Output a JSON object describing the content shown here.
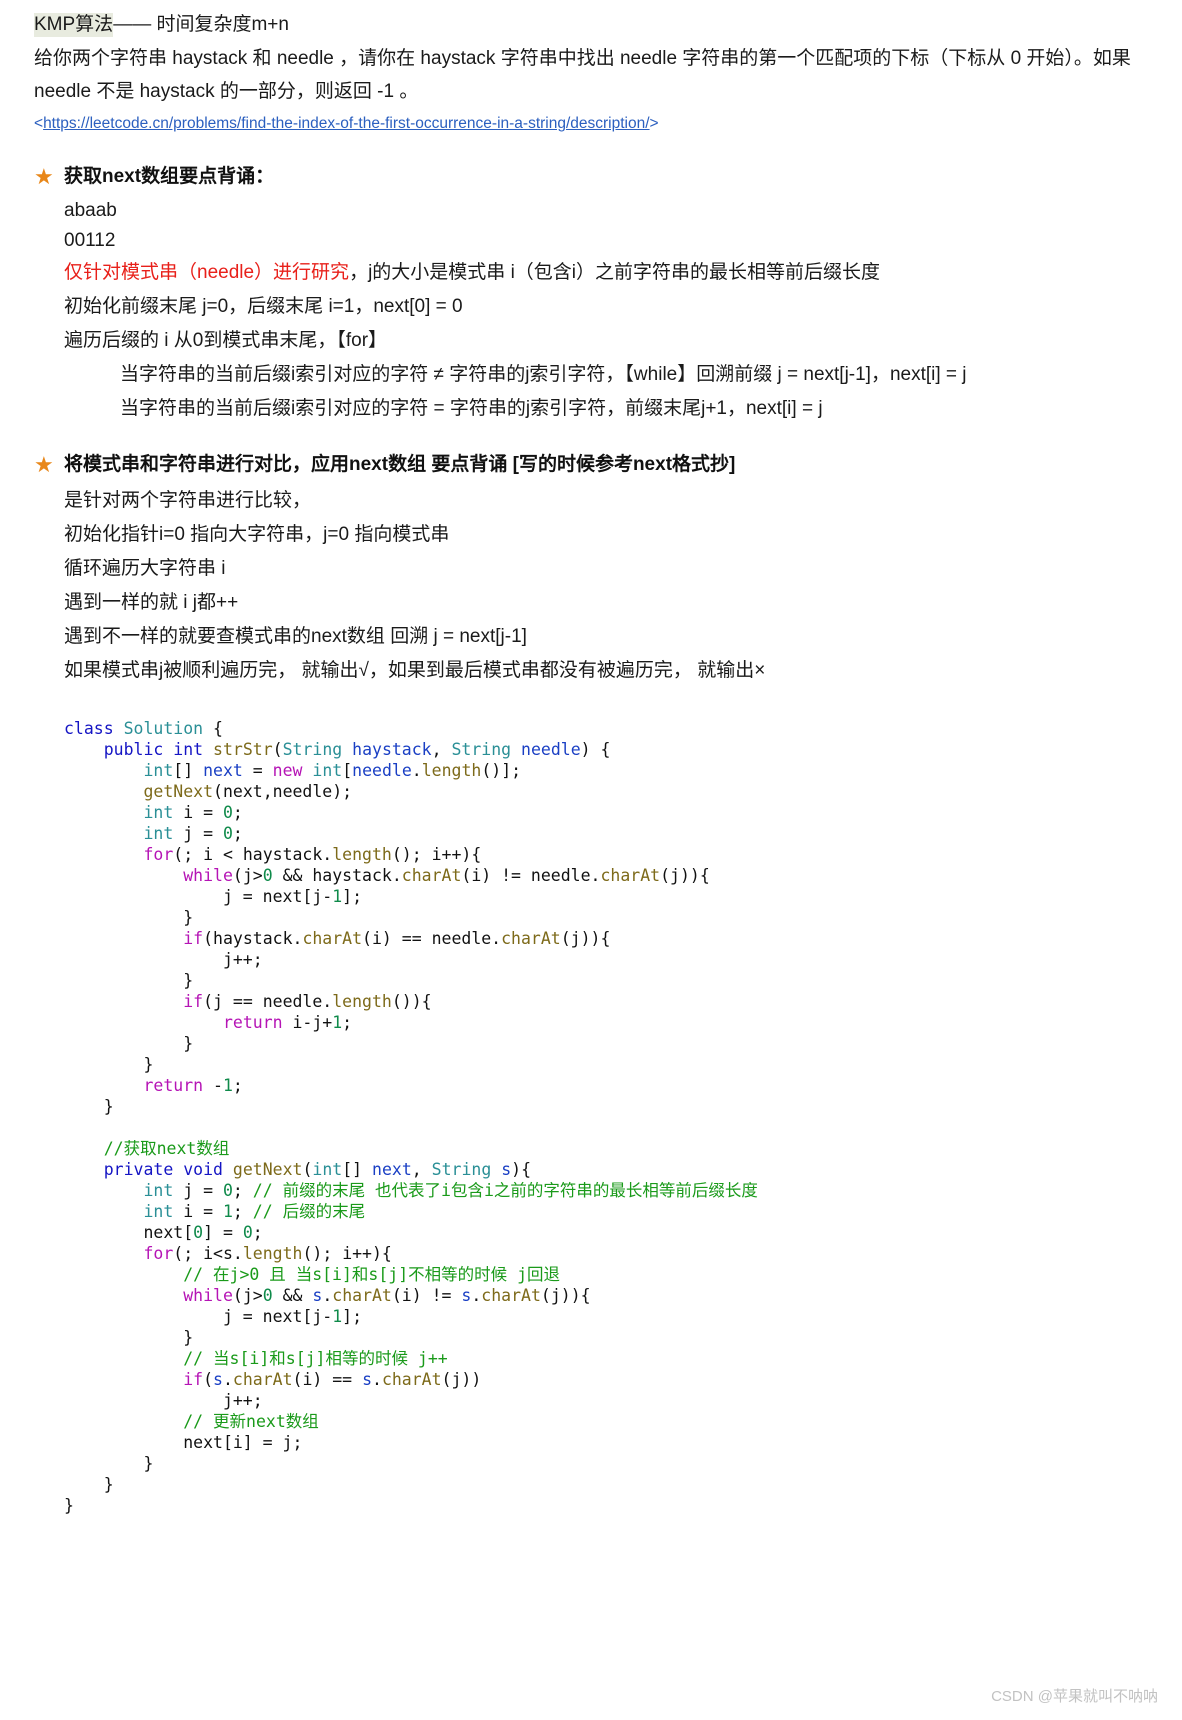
{
  "document": {
    "title_prefix": "KMP算法",
    "title_rest": "—— 时间复杂度m+n",
    "problem_statement": "给你两个字符串 haystack 和 needle ，请你在 haystack 字符串中找出 needle 字符串的第一个匹配项的下标（下标从 0 开始）。如果 needle 不是 haystack 的一部分，则返回 -1 。",
    "link_text": "https://leetcode.cn/problems/find-the-index-of-the-first-occurrence-in-a-string/description/",
    "link_open": "<",
    "link_close": ">"
  },
  "sections": [
    {
      "star": "★",
      "heading": "获取next数组要点背诵：",
      "lines": [
        {
          "text": "abaab",
          "style": "plain"
        },
        {
          "text": "00112",
          "style": "plain"
        },
        {
          "red": "仅针对模式串（needle）进行研究",
          "rest": "，j的大小是模式串 i（包含i）之前字符串的最长相等前后缀长度",
          "style": "split-red"
        },
        {
          "text": "初始化前缀末尾 j=0，后缀末尾 i=1，next[0] = 0",
          "style": "plain"
        },
        {
          "text": "遍历后缀的 i 从0到模式串末尾，【for】",
          "style": "plain"
        },
        {
          "text": "当字符串的当前后缀i索引对应的字符 ≠ 字符串的j索引字符，【while】回溯前缀 j = next[j-1]，next[i] = j",
          "style": "indent"
        },
        {
          "text": "当字符串的当前后缀i索引对应的字符 = 字符串的j索引字符，前缀末尾j+1，next[i] = j",
          "style": "indent"
        }
      ]
    },
    {
      "star": "★",
      "heading": "将模式串和字符串进行对比，应用next数组 要点背诵 [写的时候参考next格式抄]",
      "lines": [
        {
          "text": "是针对两个字符串进行比较，",
          "style": "plain"
        },
        {
          "text": "初始化指针i=0 指向大字符串，j=0 指向模式串",
          "style": "plain"
        },
        {
          "text": "循环遍历大字符串 i",
          "style": "plain"
        },
        {
          "text": "遇到一样的就 i j都++",
          "style": "plain"
        },
        {
          "text": "遇到不一样的就要查模式串的next数组 回溯 j = next[j-1]",
          "style": "plain"
        },
        {
          "text": "如果模式串j被顺利遍历完， 就输出√，如果到最后模式串都没有被遍历完， 就输出×",
          "style": "plain"
        }
      ]
    }
  ],
  "code": {
    "language": "java",
    "lines": [
      [
        {
          "t": "class ",
          "c": "kw"
        },
        {
          "t": "Solution",
          "c": "type"
        },
        {
          "t": " {",
          "c": "plain"
        }
      ],
      [
        {
          "t": "    ",
          "c": "plain"
        },
        {
          "t": "public",
          "c": "kw"
        },
        {
          "t": " ",
          "c": "plain"
        },
        {
          "t": "int",
          "c": "kw"
        },
        {
          "t": " ",
          "c": "plain"
        },
        {
          "t": "strStr",
          "c": "fn"
        },
        {
          "t": "(",
          "c": "plain"
        },
        {
          "t": "String",
          "c": "type"
        },
        {
          "t": " ",
          "c": "plain"
        },
        {
          "t": "haystack",
          "c": "var"
        },
        {
          "t": ", ",
          "c": "plain"
        },
        {
          "t": "String",
          "c": "type"
        },
        {
          "t": " ",
          "c": "plain"
        },
        {
          "t": "needle",
          "c": "var"
        },
        {
          "t": ") {",
          "c": "plain"
        }
      ],
      [
        {
          "t": "        ",
          "c": "plain"
        },
        {
          "t": "int",
          "c": "type"
        },
        {
          "t": "[] ",
          "c": "plain"
        },
        {
          "t": "next",
          "c": "var"
        },
        {
          "t": " = ",
          "c": "plain"
        },
        {
          "t": "new",
          "c": "kw2"
        },
        {
          "t": " ",
          "c": "plain"
        },
        {
          "t": "int",
          "c": "type"
        },
        {
          "t": "[",
          "c": "plain"
        },
        {
          "t": "needle",
          "c": "var"
        },
        {
          "t": ".",
          "c": "plain"
        },
        {
          "t": "length",
          "c": "fn"
        },
        {
          "t": "()];",
          "c": "plain"
        }
      ],
      [
        {
          "t": "        ",
          "c": "plain"
        },
        {
          "t": "getNext",
          "c": "fn"
        },
        {
          "t": "(next,needle);",
          "c": "plain"
        }
      ],
      [
        {
          "t": "        ",
          "c": "plain"
        },
        {
          "t": "int",
          "c": "type"
        },
        {
          "t": " i = ",
          "c": "plain"
        },
        {
          "t": "0",
          "c": "num"
        },
        {
          "t": ";",
          "c": "plain"
        }
      ],
      [
        {
          "t": "        ",
          "c": "plain"
        },
        {
          "t": "int",
          "c": "type"
        },
        {
          "t": " j = ",
          "c": "plain"
        },
        {
          "t": "0",
          "c": "num"
        },
        {
          "t": ";",
          "c": "plain"
        }
      ],
      [
        {
          "t": "        ",
          "c": "plain"
        },
        {
          "t": "for",
          "c": "kw2"
        },
        {
          "t": "(; i < haystack.",
          "c": "plain"
        },
        {
          "t": "length",
          "c": "fn"
        },
        {
          "t": "(); i++){",
          "c": "plain"
        }
      ],
      [
        {
          "t": "            ",
          "c": "plain"
        },
        {
          "t": "while",
          "c": "kw2"
        },
        {
          "t": "(j>",
          "c": "plain"
        },
        {
          "t": "0",
          "c": "num"
        },
        {
          "t": " && haystack.",
          "c": "plain"
        },
        {
          "t": "charAt",
          "c": "fn"
        },
        {
          "t": "(i) != needle.",
          "c": "plain"
        },
        {
          "t": "charAt",
          "c": "fn"
        },
        {
          "t": "(j)){",
          "c": "plain"
        }
      ],
      [
        {
          "t": "                j = next[j-",
          "c": "plain"
        },
        {
          "t": "1",
          "c": "num"
        },
        {
          "t": "];",
          "c": "plain"
        }
      ],
      [
        {
          "t": "            }",
          "c": "plain"
        }
      ],
      [
        {
          "t": "            ",
          "c": "plain"
        },
        {
          "t": "if",
          "c": "kw2"
        },
        {
          "t": "(haystack.",
          "c": "plain"
        },
        {
          "t": "charAt",
          "c": "fn"
        },
        {
          "t": "(i) == needle.",
          "c": "plain"
        },
        {
          "t": "charAt",
          "c": "fn"
        },
        {
          "t": "(j)){",
          "c": "plain"
        }
      ],
      [
        {
          "t": "                j++;",
          "c": "plain"
        }
      ],
      [
        {
          "t": "            }",
          "c": "plain"
        }
      ],
      [
        {
          "t": "            ",
          "c": "plain"
        },
        {
          "t": "if",
          "c": "kw2"
        },
        {
          "t": "(j == needle.",
          "c": "plain"
        },
        {
          "t": "length",
          "c": "fn"
        },
        {
          "t": "()){",
          "c": "plain"
        }
      ],
      [
        {
          "t": "                ",
          "c": "plain"
        },
        {
          "t": "return",
          "c": "kw2"
        },
        {
          "t": " i-j+",
          "c": "plain"
        },
        {
          "t": "1",
          "c": "num"
        },
        {
          "t": ";",
          "c": "plain"
        }
      ],
      [
        {
          "t": "            }",
          "c": "plain"
        }
      ],
      [
        {
          "t": "        }",
          "c": "plain"
        }
      ],
      [
        {
          "t": "        ",
          "c": "plain"
        },
        {
          "t": "return",
          "c": "kw2"
        },
        {
          "t": " -",
          "c": "plain"
        },
        {
          "t": "1",
          "c": "num"
        },
        {
          "t": ";",
          "c": "plain"
        }
      ],
      [
        {
          "t": "    }",
          "c": "plain"
        }
      ],
      [
        {
          "t": "",
          "c": "plain"
        }
      ],
      [
        {
          "t": "    ",
          "c": "plain"
        },
        {
          "t": "//获取next数组",
          "c": "cmt"
        }
      ],
      [
        {
          "t": "    ",
          "c": "plain"
        },
        {
          "t": "private",
          "c": "kw"
        },
        {
          "t": " ",
          "c": "plain"
        },
        {
          "t": "void",
          "c": "kw"
        },
        {
          "t": " ",
          "c": "plain"
        },
        {
          "t": "getNext",
          "c": "fn"
        },
        {
          "t": "(",
          "c": "plain"
        },
        {
          "t": "int",
          "c": "type"
        },
        {
          "t": "[] ",
          "c": "plain"
        },
        {
          "t": "next",
          "c": "var"
        },
        {
          "t": ", ",
          "c": "plain"
        },
        {
          "t": "String",
          "c": "type"
        },
        {
          "t": " ",
          "c": "plain"
        },
        {
          "t": "s",
          "c": "var"
        },
        {
          "t": "){",
          "c": "plain"
        }
      ],
      [
        {
          "t": "        ",
          "c": "plain"
        },
        {
          "t": "int",
          "c": "type"
        },
        {
          "t": " j = ",
          "c": "plain"
        },
        {
          "t": "0",
          "c": "num"
        },
        {
          "t": "; ",
          "c": "plain"
        },
        {
          "t": "// 前缀的末尾 也代表了i包含i之前的字符串的最长相等前后缀长度",
          "c": "cmt"
        }
      ],
      [
        {
          "t": "        ",
          "c": "plain"
        },
        {
          "t": "int",
          "c": "type"
        },
        {
          "t": " i = ",
          "c": "plain"
        },
        {
          "t": "1",
          "c": "num"
        },
        {
          "t": "; ",
          "c": "plain"
        },
        {
          "t": "// 后缀的末尾",
          "c": "cmt"
        }
      ],
      [
        {
          "t": "        next[",
          "c": "plain"
        },
        {
          "t": "0",
          "c": "num"
        },
        {
          "t": "] = ",
          "c": "plain"
        },
        {
          "t": "0",
          "c": "num"
        },
        {
          "t": ";",
          "c": "plain"
        }
      ],
      [
        {
          "t": "        ",
          "c": "plain"
        },
        {
          "t": "for",
          "c": "kw2"
        },
        {
          "t": "(; i<s.",
          "c": "plain"
        },
        {
          "t": "length",
          "c": "fn"
        },
        {
          "t": "(); i++){",
          "c": "plain"
        }
      ],
      [
        {
          "t": "            ",
          "c": "plain"
        },
        {
          "t": "// 在j>0 且 当s[i]和s[j]不相等的时候 j回退",
          "c": "cmt"
        }
      ],
      [
        {
          "t": "            ",
          "c": "plain"
        },
        {
          "t": "while",
          "c": "kw2"
        },
        {
          "t": "(j>",
          "c": "plain"
        },
        {
          "t": "0",
          "c": "num"
        },
        {
          "t": " && ",
          "c": "plain"
        },
        {
          "t": "s",
          "c": "var"
        },
        {
          "t": ".",
          "c": "plain"
        },
        {
          "t": "charAt",
          "c": "fn"
        },
        {
          "t": "(i) != ",
          "c": "plain"
        },
        {
          "t": "s",
          "c": "var"
        },
        {
          "t": ".",
          "c": "plain"
        },
        {
          "t": "charAt",
          "c": "fn"
        },
        {
          "t": "(j)){",
          "c": "plain"
        }
      ],
      [
        {
          "t": "                j = next[j-",
          "c": "plain"
        },
        {
          "t": "1",
          "c": "num"
        },
        {
          "t": "];",
          "c": "plain"
        }
      ],
      [
        {
          "t": "            }",
          "c": "plain"
        }
      ],
      [
        {
          "t": "            ",
          "c": "plain"
        },
        {
          "t": "// 当s[i]和s[j]相等的时候 j++",
          "c": "cmt"
        }
      ],
      [
        {
          "t": "            ",
          "c": "plain"
        },
        {
          "t": "if",
          "c": "kw2"
        },
        {
          "t": "(",
          "c": "plain"
        },
        {
          "t": "s",
          "c": "var"
        },
        {
          "t": ".",
          "c": "plain"
        },
        {
          "t": "charAt",
          "c": "fn"
        },
        {
          "t": "(i) == ",
          "c": "plain"
        },
        {
          "t": "s",
          "c": "var"
        },
        {
          "t": ".",
          "c": "plain"
        },
        {
          "t": "charAt",
          "c": "fn"
        },
        {
          "t": "(j))",
          "c": "plain"
        }
      ],
      [
        {
          "t": "                j++;",
          "c": "plain"
        }
      ],
      [
        {
          "t": "            ",
          "c": "plain"
        },
        {
          "t": "// 更新next数组",
          "c": "cmt"
        }
      ],
      [
        {
          "t": "            next[i] = j;",
          "c": "plain"
        }
      ],
      [
        {
          "t": "        }",
          "c": "plain"
        }
      ],
      [
        {
          "t": "    }",
          "c": "plain"
        }
      ],
      [
        {
          "t": "}",
          "c": "plain"
        }
      ]
    ]
  },
  "watermark": "CSDN @苹果就叫不呐呐",
  "colors": {
    "star": "#e8871a",
    "red_text": "#e8201a",
    "link": "#2b5fbf",
    "title_highlight": "#e8ebdf",
    "comment": "#1a9a1a",
    "keyword_modifier": "#1515c4",
    "keyword_control": "#b514b5",
    "type": "#2a8f96",
    "method": "#7d6a1a",
    "number": "#0f8a4a",
    "watermark": "#c2c2c2"
  }
}
